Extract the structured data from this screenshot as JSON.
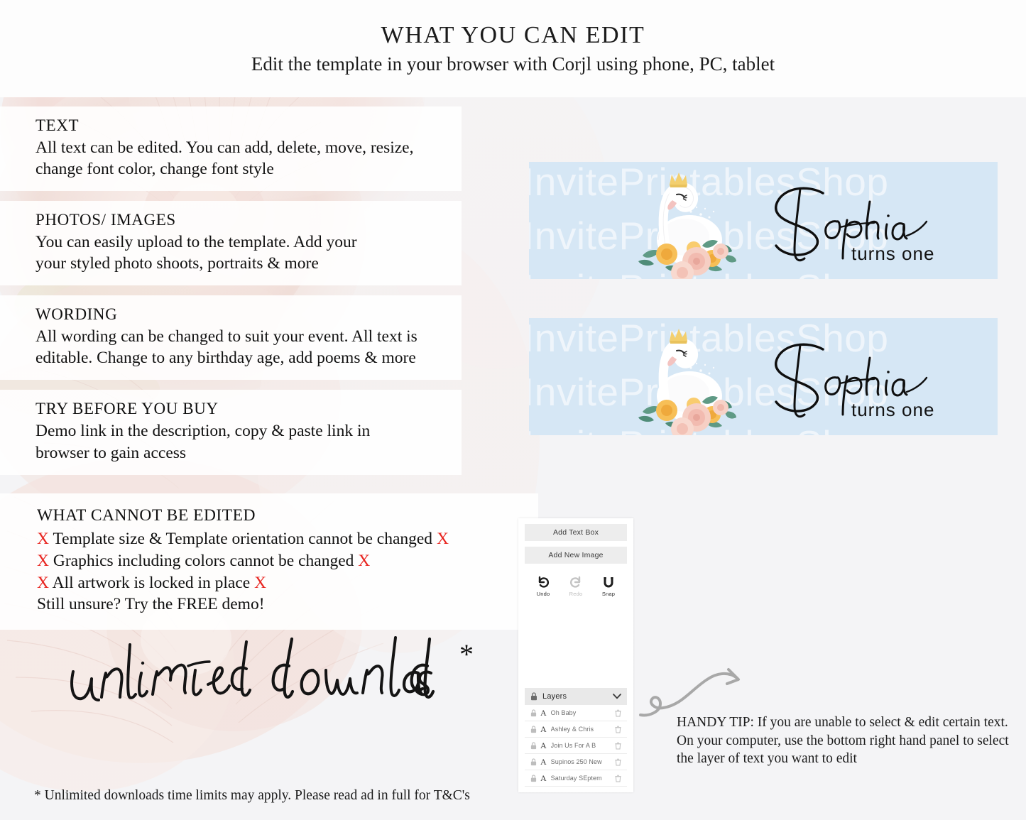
{
  "header": {
    "title": "WHAT YOU CAN EDIT",
    "subtitle": "Edit the template in your browser with Corjl using phone, PC, tablet"
  },
  "features": [
    {
      "title": "TEXT",
      "lines": [
        "All text can be edited. You can add, delete, move, resize,",
        "change font color, change font style"
      ]
    },
    {
      "title": "PHOTOS/ IMAGES",
      "lines": [
        "You can easily upload to the template. Add your",
        "your styled photo shoots, portraits & more"
      ]
    },
    {
      "title": "WORDING",
      "lines": [
        "All wording can be changed to suit your event. All text is",
        "editable. Change to any birthday age, add poems & more"
      ]
    },
    {
      "title": "TRY BEFORE YOU BUY",
      "lines": [
        "Demo link in the description, copy & paste link in",
        "browser to gain access"
      ]
    }
  ],
  "cannot_edit": {
    "title": "WHAT CANNOT BE EDITED",
    "x_mark": "X",
    "items": [
      {
        "text": "Template size & Template orientation cannot be changed",
        "lead_x": true,
        "trail_x": true
      },
      {
        "text": "Graphics including colors cannot be changed",
        "lead_x": true,
        "trail_x": true
      },
      {
        "text": "All artwork is locked in place",
        "lead_x": true,
        "trail_x": true
      }
    ],
    "closing": "Still unsure? Try the FREE demo!"
  },
  "script_headline": {
    "text": "unlimited downloads",
    "asterisk": "*"
  },
  "footnote": "* Unlimited downloads time limits may apply. Please read ad in full for T&C's",
  "previews": {
    "background_color": "#d6e7f5",
    "watermark": "InvitePrintablesShop",
    "name": "Sophia",
    "subtitle": "turns one",
    "graphic": "swan-with-crown-and-flowers"
  },
  "editor": {
    "add_text_box": "Add Text Box",
    "add_new_image": "Add New Image",
    "tools": [
      {
        "label": "Undo",
        "icon": "undo-icon",
        "disabled": false
      },
      {
        "label": "Redo",
        "icon": "redo-icon",
        "disabled": true
      },
      {
        "label": "Snap",
        "icon": "snap-magnet-icon",
        "disabled": false
      }
    ],
    "layers_title": "Layers",
    "layers": [
      "Oh Baby",
      "Ashley & Chris",
      "Join Us For A B",
      "Supinos 250 New",
      "Saturday SEptem"
    ]
  },
  "handy_tip": {
    "lines": [
      "HANDY TIP: If you are unable to select & edit certain text.",
      "On your computer, use the bottom right hand panel to select",
      "the layer of text you want to edit"
    ]
  }
}
